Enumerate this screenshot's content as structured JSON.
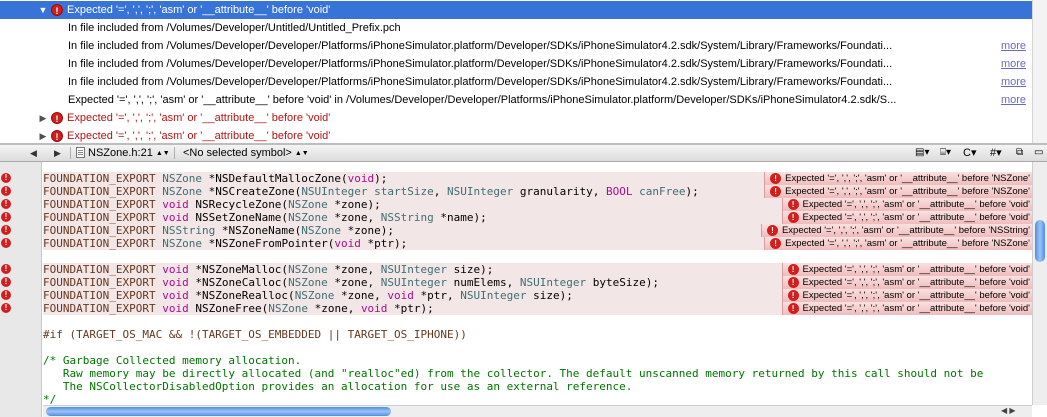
{
  "issues": {
    "rows": [
      {
        "type": "error",
        "expanded": true,
        "selected": true,
        "text": "Expected '=', ',', ';', 'asm' or '__attribute__' before 'void'"
      },
      {
        "type": "sub",
        "text": "In file included from /Volumes/Developer/Untitled/Untitled_Prefix.pch",
        "more": ""
      },
      {
        "type": "sub",
        "text": "In file included from /Volumes/Developer/Developer/Platforms/iPhoneSimulator.platform/Developer/SDKs/iPhoneSimulator4.2.sdk/System/Library/Frameworks/Foundati...",
        "more": "more"
      },
      {
        "type": "sub",
        "text": "In file included from /Volumes/Developer/Developer/Platforms/iPhoneSimulator.platform/Developer/SDKs/iPhoneSimulator4.2.sdk/System/Library/Frameworks/Foundati...",
        "more": "more"
      },
      {
        "type": "sub",
        "text": "In file included from /Volumes/Developer/Developer/Platforms/iPhoneSimulator.platform/Developer/SDKs/iPhoneSimulator4.2.sdk/System/Library/Frameworks/Foundati...",
        "more": "more"
      },
      {
        "type": "sub",
        "text": "Expected '=', ',', ';', 'asm' or '__attribute__' before 'void' in /Volumes/Developer/Developer/Platforms/iPhoneSimulator.platform/Developer/SDKs/iPhoneSimulator4.2.sdk/S...",
        "more": "more"
      },
      {
        "type": "error",
        "expanded": false,
        "selected": false,
        "text": "Expected '=', ',', ';', 'asm' or '__attribute__' before 'void'"
      },
      {
        "type": "error",
        "expanded": false,
        "selected": false,
        "text": "Expected '=', ',', ';', 'asm' or '__attribute__' before 'void'"
      }
    ]
  },
  "navbar": {
    "back": "◀",
    "forward": "▶",
    "file": "NSZone.h:21",
    "symbol": "<No selected symbol>",
    "right_c": "C",
    "right_hash": "#"
  },
  "gutter_errors": [
    true,
    true,
    true,
    true,
    true,
    true,
    false,
    true,
    true,
    true,
    true
  ],
  "code": [
    {
      "parts": [
        [
          "macro",
          "FOUNDATION_EXPORT"
        ],
        [
          "plain",
          " "
        ],
        [
          "type",
          "NSZone"
        ],
        [
          "plain",
          " *NSDefaultMallocZone("
        ],
        [
          "kw",
          "void"
        ],
        [
          "plain",
          ");"
        ]
      ],
      "error": "Expected '=', ',', ';', 'asm' or '__attribute__' before 'NSZone'"
    },
    {
      "parts": [
        [
          "macro",
          "FOUNDATION_EXPORT"
        ],
        [
          "plain",
          " "
        ],
        [
          "type",
          "NSZone"
        ],
        [
          "plain",
          " *NSCreateZone("
        ],
        [
          "type",
          "NSUInteger"
        ],
        [
          "plain",
          " "
        ],
        [
          "type",
          "startSize"
        ],
        [
          "plain",
          ", "
        ],
        [
          "type",
          "NSUInteger"
        ],
        [
          "plain",
          " granularity, "
        ],
        [
          "kw",
          "BOOL"
        ],
        [
          "plain",
          " "
        ],
        [
          "type",
          "canFree"
        ],
        [
          "plain",
          ");"
        ]
      ],
      "error": "Expected '=', ',', ';', 'asm' or '__attribute__' before 'NSZone'"
    },
    {
      "parts": [
        [
          "macro",
          "FOUNDATION_EXPORT"
        ],
        [
          "plain",
          " "
        ],
        [
          "kw",
          "void"
        ],
        [
          "plain",
          " NSRecycleZone("
        ],
        [
          "type",
          "NSZone"
        ],
        [
          "plain",
          " *zone);"
        ]
      ],
      "error": "Expected '=', ',', ';', 'asm' or '__attribute__' before 'void'"
    },
    {
      "parts": [
        [
          "macro",
          "FOUNDATION_EXPORT"
        ],
        [
          "plain",
          " "
        ],
        [
          "kw",
          "void"
        ],
        [
          "plain",
          " NSSetZoneName("
        ],
        [
          "type",
          "NSZone"
        ],
        [
          "plain",
          " *zone, "
        ],
        [
          "type",
          "NSString"
        ],
        [
          "plain",
          " *name);"
        ]
      ],
      "error": "Expected '=', ',', ';', 'asm' or '__attribute__' before 'void'"
    },
    {
      "parts": [
        [
          "macro",
          "FOUNDATION_EXPORT"
        ],
        [
          "plain",
          " "
        ],
        [
          "type",
          "NSString"
        ],
        [
          "plain",
          " *NSZoneName("
        ],
        [
          "type",
          "NSZone"
        ],
        [
          "plain",
          " *zone);"
        ]
      ],
      "error": "Expected '=', ',', ';', 'asm' or '__attribute__' before 'NSString'"
    },
    {
      "parts": [
        [
          "macro",
          "FOUNDATION_EXPORT"
        ],
        [
          "plain",
          " "
        ],
        [
          "type",
          "NSZone"
        ],
        [
          "plain",
          " *NSZoneFromPointer("
        ],
        [
          "kw",
          "void"
        ],
        [
          "plain",
          " *ptr);"
        ]
      ],
      "error": "Expected '=', ',', ';', 'asm' or '__attribute__' before 'NSZone'"
    },
    {
      "parts": [],
      "error": ""
    },
    {
      "parts": [
        [
          "macro",
          "FOUNDATION_EXPORT"
        ],
        [
          "plain",
          " "
        ],
        [
          "kw",
          "void"
        ],
        [
          "plain",
          " *NSZoneMalloc("
        ],
        [
          "type",
          "NSZone"
        ],
        [
          "plain",
          " *zone, "
        ],
        [
          "type",
          "NSUInteger"
        ],
        [
          "plain",
          " size);"
        ]
      ],
      "error": "Expected '=', ',', ';', 'asm' or '__attribute__' before 'void'"
    },
    {
      "parts": [
        [
          "macro",
          "FOUNDATION_EXPORT"
        ],
        [
          "plain",
          " "
        ],
        [
          "kw",
          "void"
        ],
        [
          "plain",
          " *NSZoneCalloc("
        ],
        [
          "type",
          "NSZone"
        ],
        [
          "plain",
          " *zone, "
        ],
        [
          "type",
          "NSUInteger"
        ],
        [
          "plain",
          " numElems, "
        ],
        [
          "type",
          "NSUInteger"
        ],
        [
          "plain",
          " byteSize);"
        ]
      ],
      "error": "Expected '=', ',', ';', 'asm' or '__attribute__' before 'void'"
    },
    {
      "parts": [
        [
          "macro",
          "FOUNDATION_EXPORT"
        ],
        [
          "plain",
          " "
        ],
        [
          "kw",
          "void"
        ],
        [
          "plain",
          " *NSZoneRealloc("
        ],
        [
          "type",
          "NSZone"
        ],
        [
          "plain",
          " *zone, "
        ],
        [
          "kw",
          "void"
        ],
        [
          "plain",
          " *ptr, "
        ],
        [
          "type",
          "NSUInteger"
        ],
        [
          "plain",
          " size);"
        ]
      ],
      "error": "Expected '=', ',', ';', 'asm' or '__attribute__' before 'void'"
    },
    {
      "parts": [
        [
          "macro",
          "FOUNDATION_EXPORT"
        ],
        [
          "plain",
          " "
        ],
        [
          "kw",
          "void"
        ],
        [
          "plain",
          " NSZoneFree("
        ],
        [
          "type",
          "NSZone"
        ],
        [
          "plain",
          " *zone, "
        ],
        [
          "kw",
          "void"
        ],
        [
          "plain",
          " *ptr);"
        ]
      ],
      "error": "Expected '=', ',', ';', 'asm' or '__attribute__' before 'void'"
    },
    {
      "parts": [],
      "error": ""
    },
    {
      "parts": [
        [
          "pre",
          "#if (TARGET_OS_MAC && !(TARGET_OS_EMBEDDED || TARGET_OS_IPHONE))"
        ]
      ],
      "error": ""
    },
    {
      "parts": [],
      "error": ""
    },
    {
      "parts": [
        [
          "comment",
          "/* Garbage Collected memory allocation."
        ]
      ],
      "error": ""
    },
    {
      "parts": [
        [
          "comment",
          "   Raw memory may be directly allocated (and \"realloc\"ed) from the collector. The default unscanned memory returned by this call should not be"
        ]
      ],
      "error": ""
    },
    {
      "parts": [
        [
          "comment",
          "   The NSCollectorDisabledOption provides an allocation for use as an external reference."
        ]
      ],
      "error": ""
    },
    {
      "parts": [
        [
          "comment",
          "*/"
        ]
      ],
      "error": ""
    }
  ],
  "icons": {
    "error": "error-icon",
    "file": "file-icon",
    "expanded": "disclosure-down-icon",
    "collapsed": "disclosure-right-icon"
  },
  "colors": {
    "selection": "#3874d7",
    "error_text": "#b31414",
    "error_icon": "#d11f1f",
    "keyword": "#aa0d91",
    "type": "#3f6e74",
    "comment": "#007400",
    "macro": "#643820"
  }
}
